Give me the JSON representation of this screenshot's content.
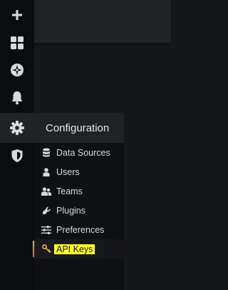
{
  "sidemenu": {
    "items": [
      {
        "icon": "plus-icon"
      },
      {
        "icon": "dashboards-grid-icon"
      },
      {
        "icon": "compass-icon"
      },
      {
        "icon": "bell-icon"
      },
      {
        "icon": "gear-icon"
      },
      {
        "icon": "shield-icon"
      }
    ]
  },
  "config_menu": {
    "title": "Configuration",
    "items": [
      {
        "label": "Data Sources",
        "icon": "database-icon"
      },
      {
        "label": "Users",
        "icon": "user-icon"
      },
      {
        "label": "Teams",
        "icon": "users-icon"
      },
      {
        "label": "Plugins",
        "icon": "plug-icon"
      },
      {
        "label": "Preferences",
        "icon": "sliders-icon"
      },
      {
        "label": "API Keys",
        "icon": "key-icon",
        "active": true,
        "highlight_color": "#ffff33"
      }
    ]
  },
  "colors": {
    "accent_gradient_top": "#ffb357",
    "accent_gradient_bottom": "#f05a28",
    "text": "#d8d9da"
  }
}
